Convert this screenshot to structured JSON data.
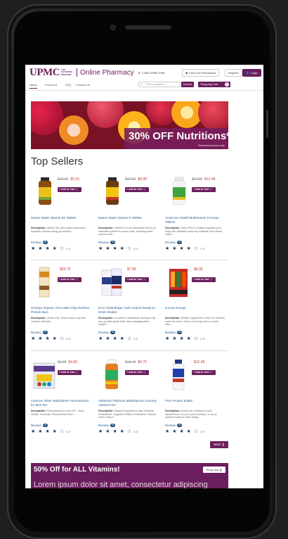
{
  "header": {
    "brand": "UPMC",
    "brand_sub": "LIFE CHANGING MEDICINE",
    "title": "Online Pharmacy",
    "phone": "1 800 UPMC PHA",
    "find_pharmacy": "Find Our Pharmacies",
    "register": "Register",
    "login": "Login"
  },
  "nav": {
    "items": [
      "Home",
      "Product ▾",
      "FAQ",
      "Contact Us"
    ],
    "search_placeholder": "Find a product",
    "search_button": "Search",
    "cart_label": "Shopping Cart",
    "cart_count": "0"
  },
  "banner": {
    "headline": "30% OFF Nutritions*",
    "note": "*Selected brands only"
  },
  "section_title": "Top Sellers",
  "add_to_cart_label": "+ Add to Cart",
  "review_label": "Review",
  "products": [
    {
      "name": "Nature Made Vitamin B6 Tablets",
      "old_price": "$10.25",
      "price": "$5.15",
      "desc_label": "Description:",
      "desc": "vitamin B6, also called pyridoxine, supports cellular energy production...",
      "reviews": "40",
      "rating": "4.4",
      "stars": "★ ★ ★ ★ ☆"
    },
    {
      "name": "Nature Made Vitamin E Tablets",
      "old_price": "$17.99",
      "price": "$8.99",
      "desc_label": "Description:",
      "desc": "Vitamin E is an antioxidant and is an essential nutrient for many cells, including heart muscle cells...",
      "reviews": "40",
      "rating": "4.3",
      "stars": "★ ★ ★ ★ ☆"
    },
    {
      "name": "American Health Multivitamin Formula Tablets",
      "old_price": "$24.99",
      "price": "$12.49",
      "desc_label": "Description:",
      "desc": "Silver Plus & Multiple supplies your body with naturally occurring nutrients from whole foods...",
      "reviews": "34",
      "rating": "4.0",
      "stars": "★ ★ ★ ★ ☆"
    },
    {
      "name": "22 Days Organic Chocolate Chip Nutrition Protein Bars",
      "old_price": "",
      "price": "$35.79",
      "desc_label": "Description:",
      "desc": "Gluten free, Plant based, soy free, contains ultimate...",
      "reviews": "14",
      "rating": "4.0",
      "stars": "★ ★ ★ ★ ☆"
    },
    {
      "name": "EAS AdvantEdge Carb Control Ready-to-Drink Shakes",
      "old_price": "",
      "price": "$7.99",
      "desc_label": "Description:",
      "desc": "an ideal for individuals looking to fat burn protein goals while also managing their weight...",
      "reviews": "34",
      "rating": "4.0",
      "stars": "★ ★ ★ ★ ☆"
    },
    {
      "name": "5-Hour Energy",
      "old_price": "",
      "price": "$8.99",
      "desc_label": "Description:",
      "desc": "Dietary Supplement. Feel it in minutes. Lasts for hours. Hours of energy now no crash later...",
      "reviews": "34",
      "rating": "4.0",
      "stars": "★ ★ ★ ★ ☆"
    },
    {
      "name": "Centrum Silver Multivitamin Personalized for Men 50+",
      "old_price": "$9.99",
      "price": "$4.99",
      "desc_label": "Description:",
      "desc": "Personalized for men 50+. Heart Health, Immunity, Personalized Stren...",
      "reviews": "34",
      "rating": "4.0",
      "stars": "★ ★ ★ ★ ☆"
    },
    {
      "name": "Vitafusion Platinum Multivitamins Gummy Vitamins 50+",
      "old_price": "$13.49",
      "price": "$6.75",
      "desc_label": "Description:",
      "desc": "Dietary Supplement, Age essential multivitamin. Supports healthy cholesterol. Natural color & flavor...",
      "reviews": "34",
      "rating": "4.0",
      "stars": "★ ★ ★ ★ ☆"
    },
    {
      "name": "Pure Protein Shake",
      "old_price": "",
      "price": "$12.99",
      "desc_label": "Description:",
      "desc": "perfect as a delicious meal replacement, for pre & post workout, or as an anytime snack to drink ready...",
      "reviews": "34",
      "rating": "4.0",
      "stars": "★ ★ ★ ★ ☆"
    }
  ],
  "more_label": "More ❯",
  "promo": {
    "title": "50% Off for ALL Vitamins!",
    "button": "Shop now ❯",
    "ghost": "Lorem ipsum dolor sit amet, consectetur adipiscing"
  },
  "colors": {
    "brand_purple": "#6b1e5d",
    "link_blue": "#2a5f93",
    "sale_red": "#c0392b"
  }
}
